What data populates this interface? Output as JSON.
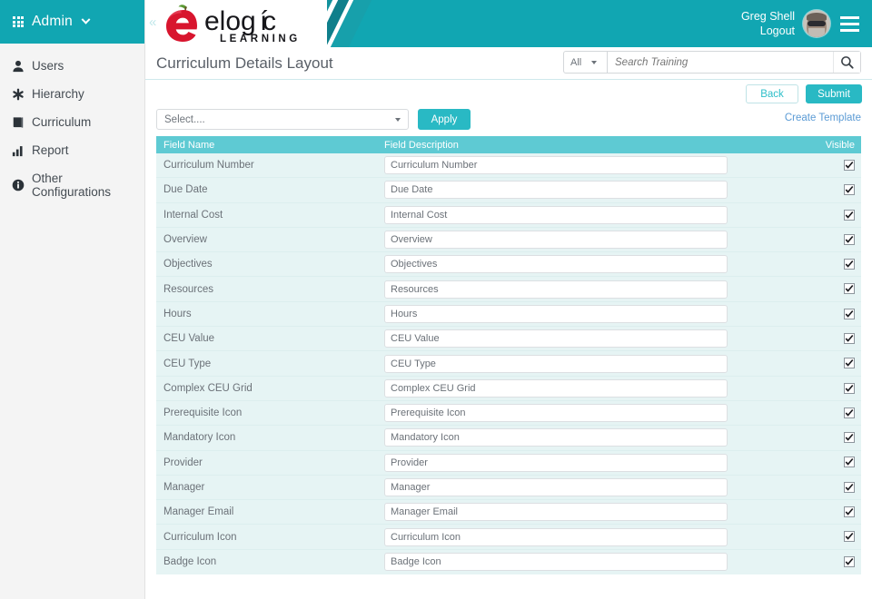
{
  "sidebar": {
    "admin": {
      "label": "Admin",
      "grid_icon": "grid-icon",
      "chevron_icon": "chevron-down-icon"
    },
    "items": [
      {
        "label": "Users",
        "icon": "user-icon"
      },
      {
        "label": "Hierarchy",
        "icon": "asterisk-icon"
      },
      {
        "label": "Curriculum",
        "icon": "book-icon"
      },
      {
        "label": "Report",
        "icon": "bar-chart-icon"
      },
      {
        "label": "Other Configurations",
        "icon": "info-circle-icon"
      }
    ]
  },
  "header": {
    "collapse_icon": "double-chevron-left-icon",
    "logo": {
      "word": "elogíc",
      "tagline": "LEARNING",
      "icon": "apple-e-logo"
    },
    "user_name": "Greg Shell",
    "logout_label": "Logout",
    "avatar_icon": "avatar",
    "menu_icon": "hamburger-menu-icon",
    "brand_color": "#11a6b2"
  },
  "title_bar": {
    "page_title": "Curriculum Details Layout",
    "search": {
      "scope_value": "All",
      "placeholder": "Search Training",
      "value": "",
      "search_icon": "search-icon",
      "caret_icon": "caret-down-icon"
    }
  },
  "actions": {
    "back_label": "Back",
    "submit_label": "Submit",
    "accent_color": "#29b9c4"
  },
  "filters": {
    "select_value": "Select....",
    "apply_label": "Apply",
    "create_template_label": "Create Template",
    "link_color": "#5b9bd5"
  },
  "table": {
    "header_color": "#5ecad3",
    "columns": {
      "field_name": "Field Name",
      "field_description": "Field Description",
      "visible": "Visible"
    },
    "rows": [
      {
        "name": "Curriculum Number",
        "description": "Curriculum Number",
        "visible": true
      },
      {
        "name": "Due Date",
        "description": "Due Date",
        "visible": true
      },
      {
        "name": "Internal Cost",
        "description": "Internal Cost",
        "visible": true
      },
      {
        "name": "Overview",
        "description": "Overview",
        "visible": true
      },
      {
        "name": "Objectives",
        "description": "Objectives",
        "visible": true
      },
      {
        "name": "Resources",
        "description": "Resources",
        "visible": true
      },
      {
        "name": "Hours",
        "description": "Hours",
        "visible": true
      },
      {
        "name": "CEU Value",
        "description": "CEU Value",
        "visible": true
      },
      {
        "name": "CEU Type",
        "description": "CEU Type",
        "visible": true
      },
      {
        "name": "Complex CEU Grid",
        "description": "Complex CEU Grid",
        "visible": true
      },
      {
        "name": "Prerequisite Icon",
        "description": "Prerequisite Icon",
        "visible": true
      },
      {
        "name": "Mandatory Icon",
        "description": "Mandatory Icon",
        "visible": true
      },
      {
        "name": "Provider",
        "description": "Provider",
        "visible": true
      },
      {
        "name": "Manager",
        "description": "Manager",
        "visible": true
      },
      {
        "name": "Manager Email",
        "description": "Manager Email",
        "visible": true
      },
      {
        "name": "Curriculum Icon",
        "description": "Curriculum Icon",
        "visible": true
      },
      {
        "name": "Badge Icon",
        "description": "Badge Icon",
        "visible": true
      }
    ]
  }
}
